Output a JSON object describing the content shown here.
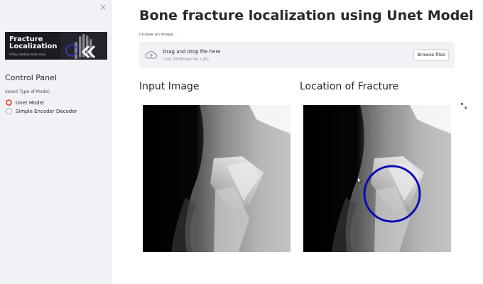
{
  "sidebar": {
    "close_label": "×",
    "banner": {
      "title": "Fracture Localization",
      "subtitle": "X-Ray reading made easy"
    },
    "panel_title": "Control Panel",
    "model_select": {
      "label": "Select Type of Model:",
      "options": [
        "Unet Model",
        "Simple Encoder Decoder"
      ],
      "selected": "Unet Model"
    }
  },
  "main": {
    "title": "Bone fracture localization using Unet Model",
    "uploader": {
      "label": "Choose an image...",
      "dropzone_title": "Drag and drop file here",
      "limit_text": "Limit 200MB per file • JPG",
      "browse_label": "Browse files"
    },
    "input_heading": "Input Image",
    "output_heading": "Location of Fracture"
  },
  "colors": {
    "accent": "#ff4b4b",
    "marker": "#0a0ab4",
    "sidebar_bg": "#f0f2f6"
  },
  "icons": [
    "close-icon",
    "cloud-upload-icon",
    "expand-icon",
    "cursor-icon"
  ]
}
